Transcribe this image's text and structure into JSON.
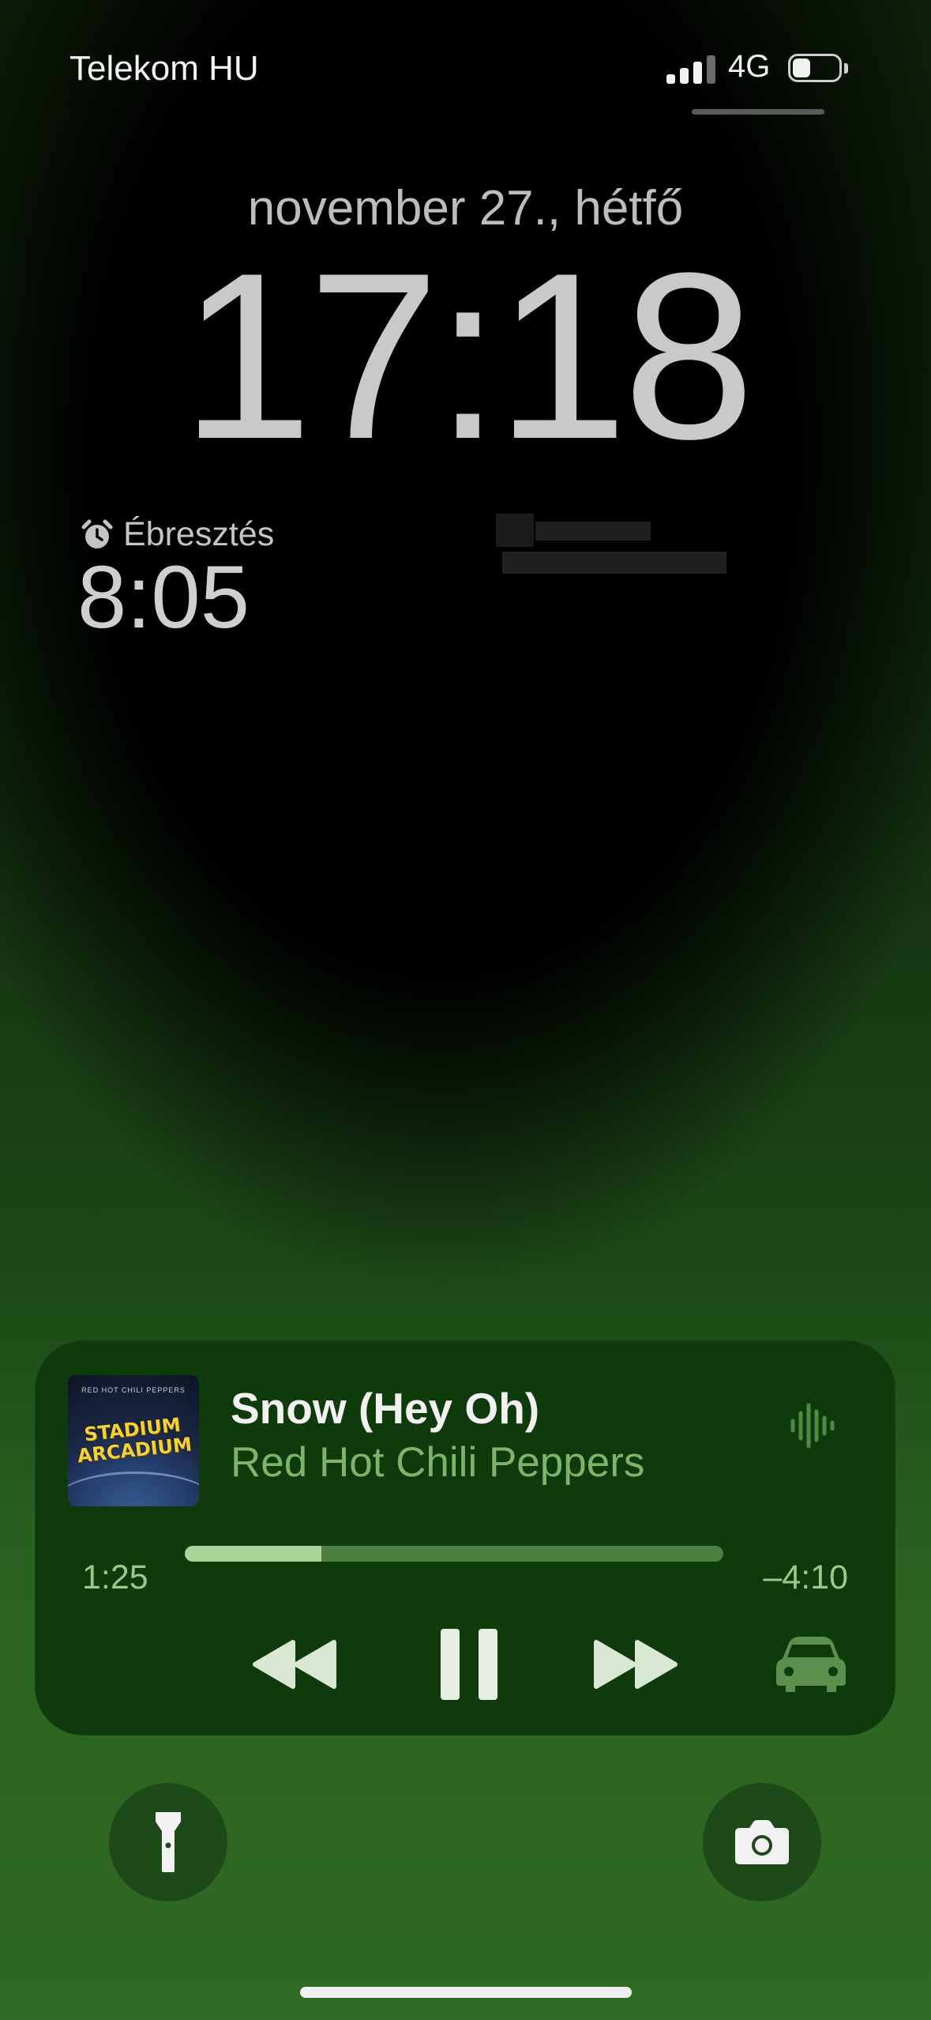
{
  "status_bar": {
    "carrier": "Telekom HU",
    "network": "4G",
    "battery_level": 0.2,
    "signal_bars": 3
  },
  "lock_screen": {
    "date": "november 27., hétfő",
    "time": "17:18"
  },
  "alarm_widget": {
    "icon": "alarm-clock-icon",
    "label": "Ébresztés",
    "time": "8:05"
  },
  "now_playing": {
    "title": "Snow (Hey Oh)",
    "artist": "Red Hot Chili Peppers",
    "album_art_top_text": "RED HOT CHILI PEPPERS",
    "album_art_title": "STADIUM ARCADIUM",
    "elapsed": "1:25",
    "remaining": "–4:10",
    "progress": 0.253,
    "output_icon": "car-icon"
  },
  "quick_actions": {
    "left_icon": "flashlight-icon",
    "right_icon": "camera-icon"
  },
  "colors": {
    "player_bg": "#0f3a0c",
    "artist_green": "#7fb36b",
    "progress_fill": "#a9d59a"
  }
}
